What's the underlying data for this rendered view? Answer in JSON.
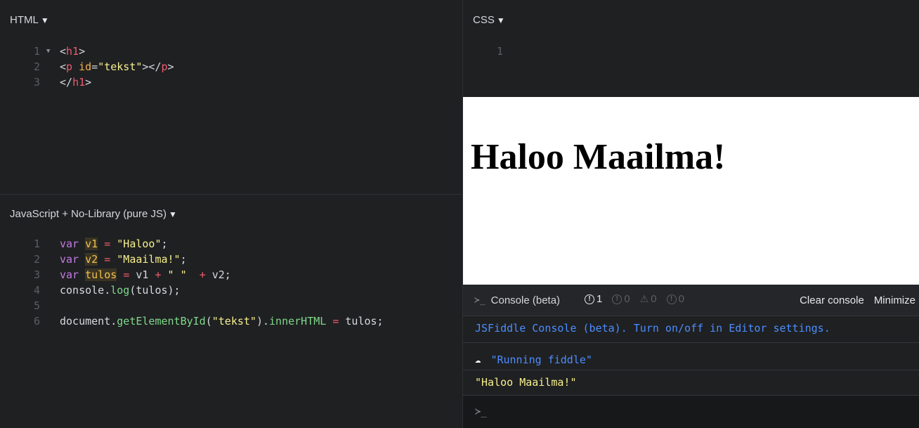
{
  "html_panel": {
    "title": "HTML",
    "lines": [
      {
        "num": "1",
        "parts": [
          [
            "t-plain",
            "<"
          ],
          [
            "t-tag",
            "h1"
          ],
          [
            "t-plain",
            ">"
          ]
        ]
      },
      {
        "num": "2",
        "parts": [
          [
            "t-plain",
            "<"
          ],
          [
            "t-tag",
            "p"
          ],
          [
            "t-plain",
            " "
          ],
          [
            "t-attr",
            "id"
          ],
          [
            "t-plain",
            "="
          ],
          [
            "t-str",
            "\"tekst\""
          ],
          [
            "t-plain",
            "></"
          ],
          [
            "t-tag",
            "p"
          ],
          [
            "t-plain",
            ">"
          ]
        ]
      },
      {
        "num": "3",
        "parts": [
          [
            "t-plain",
            "</"
          ],
          [
            "t-tag",
            "h1"
          ],
          [
            "t-plain",
            ">"
          ]
        ]
      }
    ]
  },
  "css_panel": {
    "title": "CSS",
    "lines": [
      {
        "num": "1",
        "parts": []
      }
    ]
  },
  "js_panel": {
    "title": "JavaScript + No-Library (pure JS)",
    "lines": [
      {
        "num": "1",
        "parts": [
          [
            "t-kw",
            "var"
          ],
          [
            "t-plain",
            " "
          ],
          [
            "t-var",
            "v1"
          ],
          [
            "t-plain",
            " "
          ],
          [
            "t-op",
            "="
          ],
          [
            "t-plain",
            " "
          ],
          [
            "t-str",
            "\"Haloo\""
          ],
          [
            "t-plain",
            ";"
          ]
        ]
      },
      {
        "num": "2",
        "parts": [
          [
            "t-kw",
            "var"
          ],
          [
            "t-plain",
            " "
          ],
          [
            "t-var",
            "v2"
          ],
          [
            "t-plain",
            " "
          ],
          [
            "t-op",
            "="
          ],
          [
            "t-plain",
            " "
          ],
          [
            "t-str",
            "\"Maailma!\""
          ],
          [
            "t-plain",
            ";"
          ]
        ]
      },
      {
        "num": "3",
        "parts": [
          [
            "t-kw",
            "var"
          ],
          [
            "t-plain",
            " "
          ],
          [
            "t-var",
            "tulos"
          ],
          [
            "t-plain",
            " "
          ],
          [
            "t-op",
            "="
          ],
          [
            "t-plain",
            " v1 "
          ],
          [
            "t-op",
            "+"
          ],
          [
            "t-plain",
            " "
          ],
          [
            "t-str",
            "\" \""
          ],
          [
            "t-plain",
            "  "
          ],
          [
            "t-op",
            "+"
          ],
          [
            "t-plain",
            " v2;"
          ]
        ]
      },
      {
        "num": "4",
        "parts": [
          [
            "t-plain",
            "console."
          ],
          [
            "t-fn",
            "log"
          ],
          [
            "t-plain",
            "(tulos);"
          ]
        ]
      },
      {
        "num": "5",
        "parts": []
      },
      {
        "num": "6",
        "parts": [
          [
            "t-plain",
            "document."
          ],
          [
            "t-fn",
            "getElementById"
          ],
          [
            "t-plain",
            "("
          ],
          [
            "t-str",
            "\"tekst\""
          ],
          [
            "t-plain",
            ")."
          ],
          [
            "t-fn",
            "innerHTML"
          ],
          [
            "t-plain",
            " "
          ],
          [
            "t-op",
            "="
          ],
          [
            "t-plain",
            " tulos;"
          ]
        ]
      }
    ]
  },
  "result": {
    "heading": "Haloo Maailma!"
  },
  "console": {
    "prompt_glyph": "≻_",
    "title": "Console (beta)",
    "counts": {
      "errors": "1",
      "warnings_a": "0",
      "warnings_b": "0",
      "info": "0"
    },
    "clear_label": "Clear console",
    "minimize_label": "Minimize",
    "entries": {
      "notice": "JSFiddle Console (beta). Turn on/off in Editor settings.",
      "running": "\"Running fiddle\"",
      "output": "\"Haloo Maailma!\""
    },
    "input_prompt": "≻_"
  }
}
